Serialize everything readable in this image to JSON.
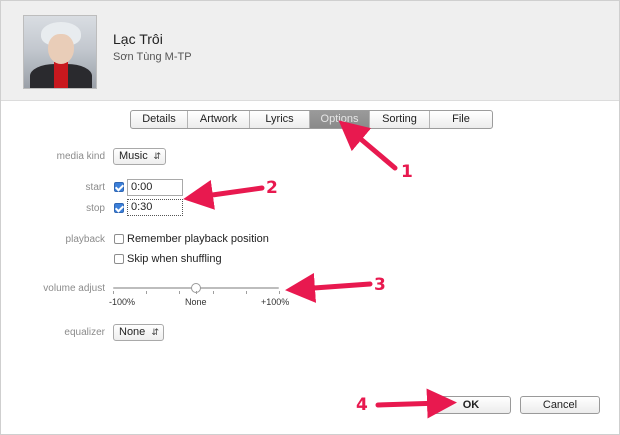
{
  "track": {
    "title": "Lạc Trôi",
    "artist": "Sơn Tùng M-TP"
  },
  "tabs": [
    {
      "label": "Details"
    },
    {
      "label": "Artwork"
    },
    {
      "label": "Lyrics"
    },
    {
      "label": "Options",
      "active": true
    },
    {
      "label": "Sorting"
    },
    {
      "label": "File"
    }
  ],
  "options": {
    "media_kind_label": "media kind",
    "media_kind_value": "Music",
    "start_label": "start",
    "start_value": "0:00",
    "start_checked": true,
    "stop_label": "stop",
    "stop_value": "0:30",
    "stop_checked": true,
    "playback_label": "playback",
    "remember_label": "Remember playback position",
    "remember_checked": false,
    "skip_label": "Skip when shuffling",
    "skip_checked": false,
    "volume_label": "volume adjust",
    "volume_min": "-100%",
    "volume_mid": "None",
    "volume_max": "+100%",
    "volume_value_fraction": 0.5,
    "equalizer_label": "equalizer",
    "equalizer_value": "None"
  },
  "buttons": {
    "ok": "OK",
    "cancel": "Cancel"
  },
  "annotations": {
    "n1": "1",
    "n2": "2",
    "n3": "3",
    "n4": "4",
    "arrow_color": "#e8194f"
  },
  "icons": {
    "select_chevron": "⌃⌄"
  }
}
